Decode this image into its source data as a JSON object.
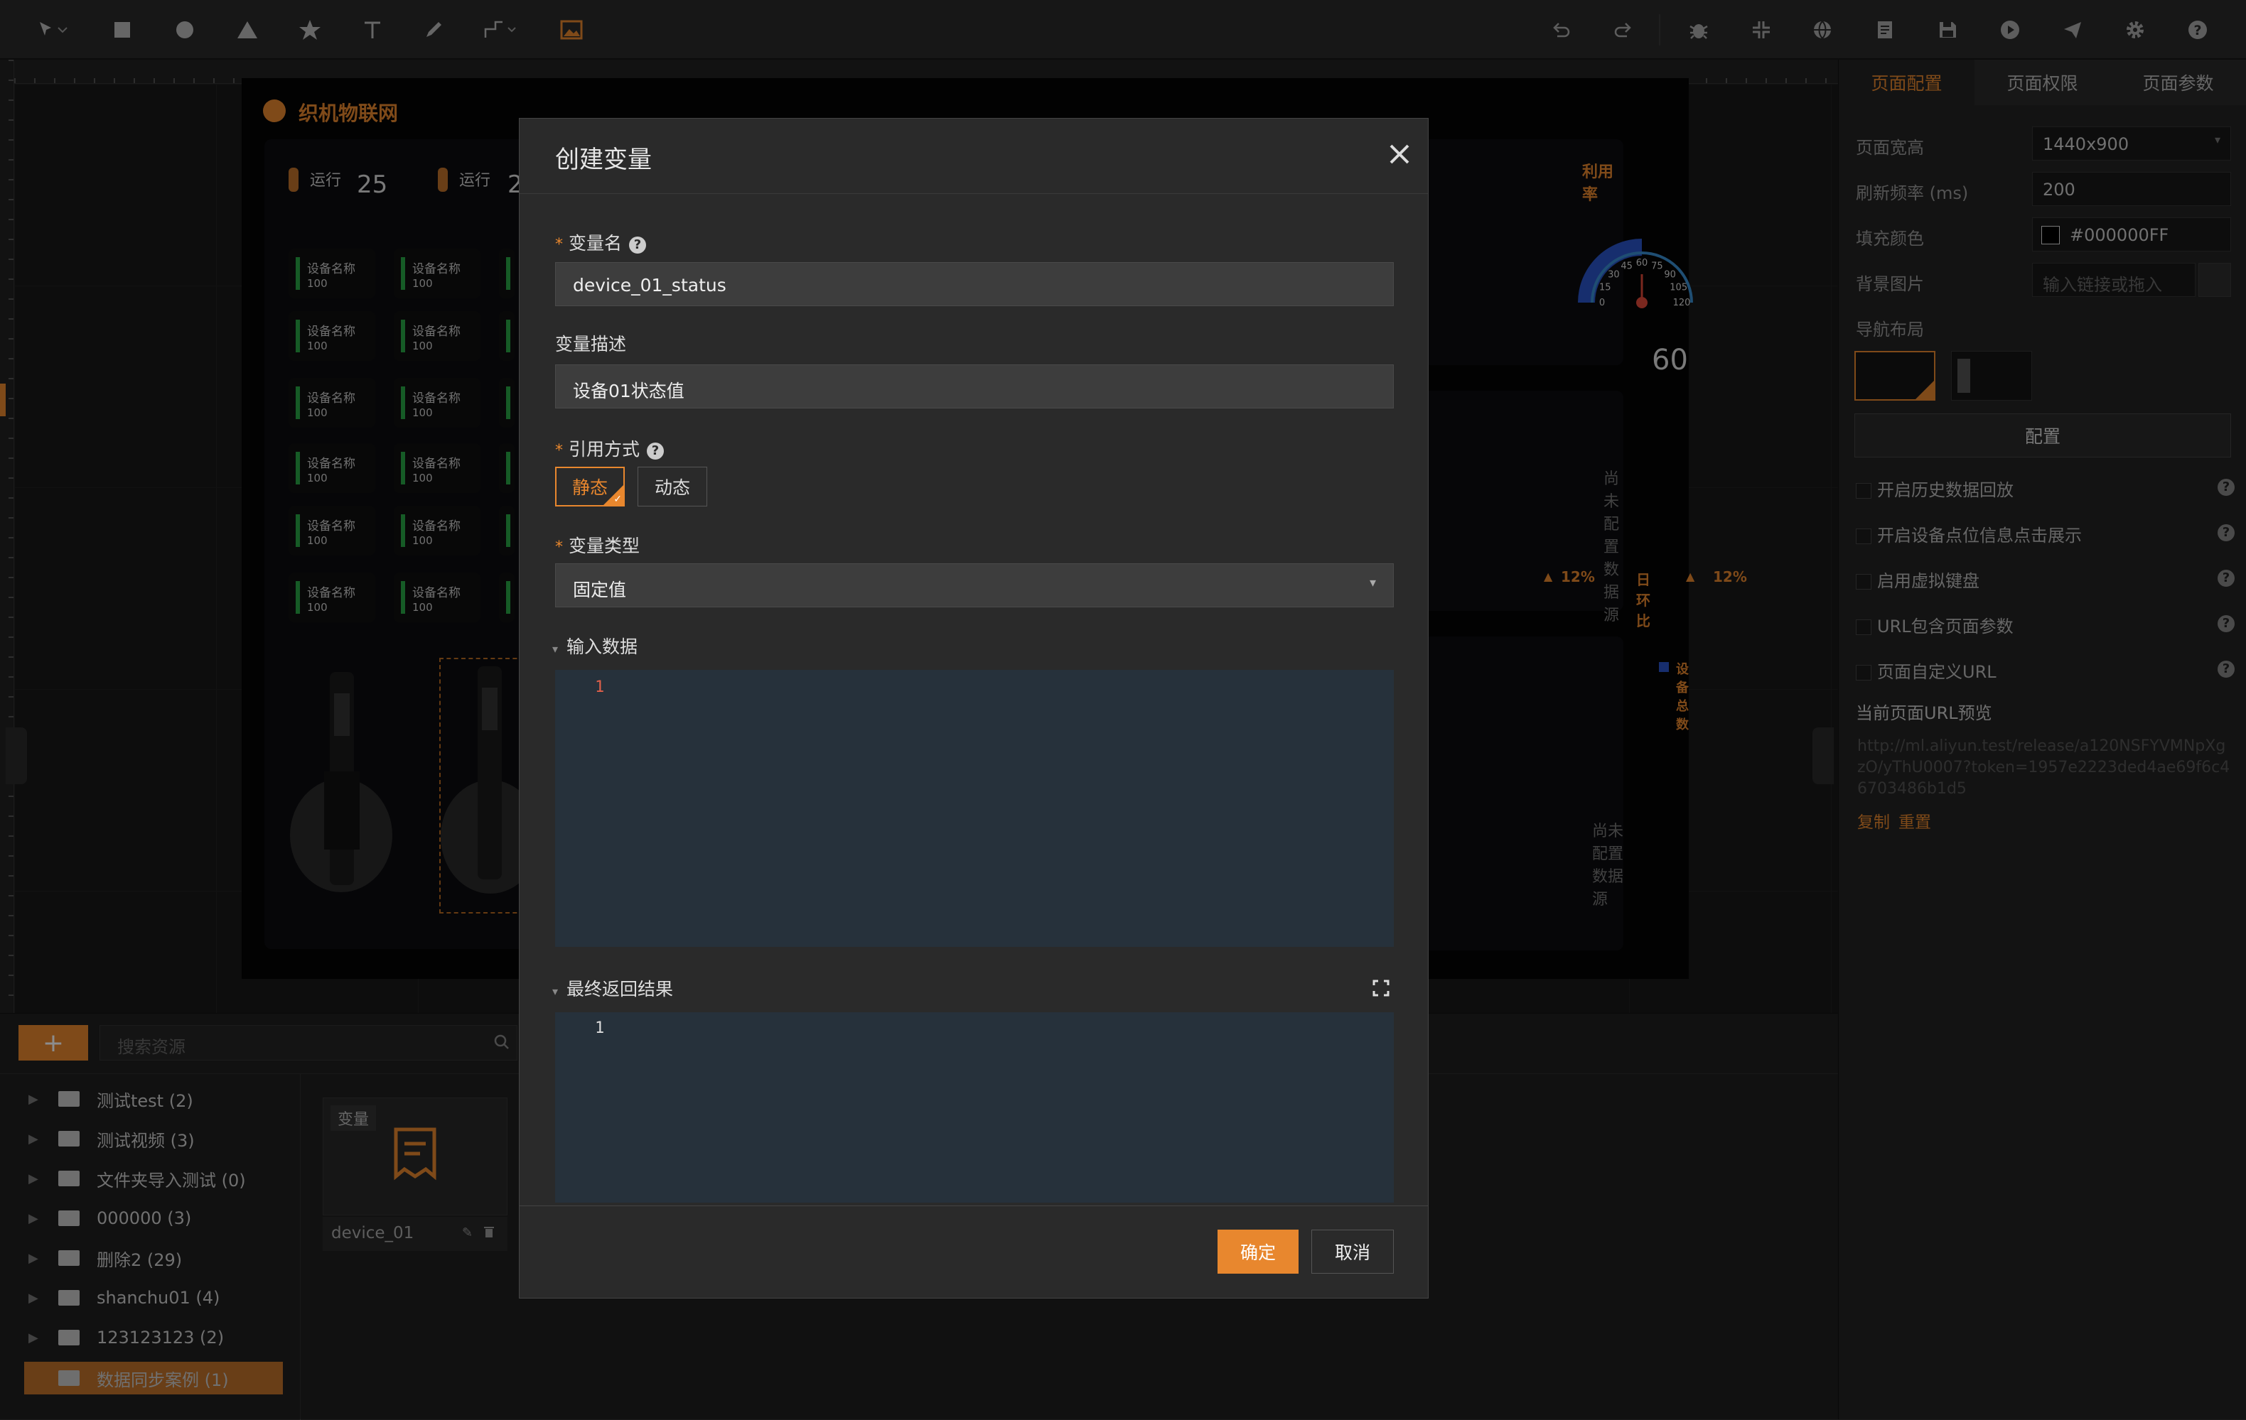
{
  "colors": {
    "accent": "#e8872e",
    "status_green": "#28a745",
    "editor_bg": "#26313b"
  },
  "toolbar": {
    "left_icons": [
      "pointer-icon",
      "rectangle-icon",
      "circle-icon",
      "triangle-icon",
      "star-icon",
      "text-icon",
      "pen-icon",
      "connector-icon",
      "image-icon"
    ],
    "right_icons": [
      "undo-icon",
      "redo-icon",
      "bug-icon",
      "compress-icon",
      "globe-icon",
      "document-icon",
      "save-icon",
      "play-icon",
      "send-icon",
      "gear-icon",
      "help-icon"
    ]
  },
  "dashboard": {
    "title": "织机物联网",
    "stat1_label": "运行",
    "stat1_value": "25",
    "stat2_label": "运行",
    "stat2_value": "2",
    "device_name": "设备名称",
    "device_value": "100",
    "gauge_title": "利用率",
    "gauge_value": "60",
    "gauge_ticks": [
      "0",
      "15",
      "30",
      "45",
      "60",
      "75",
      "90",
      "105",
      "120"
    ],
    "no_data_1": "尚未配置数据源",
    "no_data_2": "尚未配置数据源",
    "pct_left": "12%",
    "ratio_label": "日环比",
    "pct_right": "12%",
    "legend_label": "设备总数"
  },
  "right_panel": {
    "tabs": [
      "页面配置",
      "页面权限",
      "页面参数"
    ],
    "width_label": "页面宽高",
    "width_value": "1440x900",
    "refresh_label": "刷新频率 (ms)",
    "refresh_value": "200",
    "fill_label": "填充颜色",
    "fill_value": "#000000FF",
    "bg_label": "背景图片",
    "bg_placeholder": "输入链接或拖入",
    "nav_label": "导航布局",
    "config_button": "配置",
    "checks": [
      "开启历史数据回放",
      "开启设备点位信息点击展示",
      "启用虚拟键盘",
      "URL包含页面参数",
      "页面自定义URL"
    ],
    "url_preview_label": "当前页面URL预览",
    "url_preview": "http://ml.aliyun.test/release/a120NSFYVMNpXgzO/yThU0007?token=1957e2223ded4ae69f6c46703486b1d5",
    "copy": "复制",
    "reset": "重置"
  },
  "resources": {
    "search_placeholder": "搜索资源",
    "add_label": "+",
    "folders": [
      {
        "name": "测试test (2)"
      },
      {
        "name": "测试视频 (3)"
      },
      {
        "name": "文件夹导入测试 (0)"
      },
      {
        "name": "000000 (3)"
      },
      {
        "name": "删除2 (29)"
      },
      {
        "name": "shanchu01 (4)"
      },
      {
        "name": "123123123 (2)"
      },
      {
        "name": "数据同步案例 (1)"
      }
    ],
    "card_tag": "变量",
    "card_name": "device_01"
  },
  "modal": {
    "title": "创建变量",
    "name_label": "变量名",
    "name_value": "device_01_status",
    "desc_label": "变量描述",
    "desc_value": "设备01状态值",
    "ref_label": "引用方式",
    "ref_static": "静态",
    "ref_dynamic": "动态",
    "type_label": "变量类型",
    "type_value": "固定值",
    "input_section": "输入数据",
    "input_line": "1",
    "result_section": "最终返回结果",
    "result_line": "1",
    "confirm": "确定",
    "cancel": "取消"
  }
}
